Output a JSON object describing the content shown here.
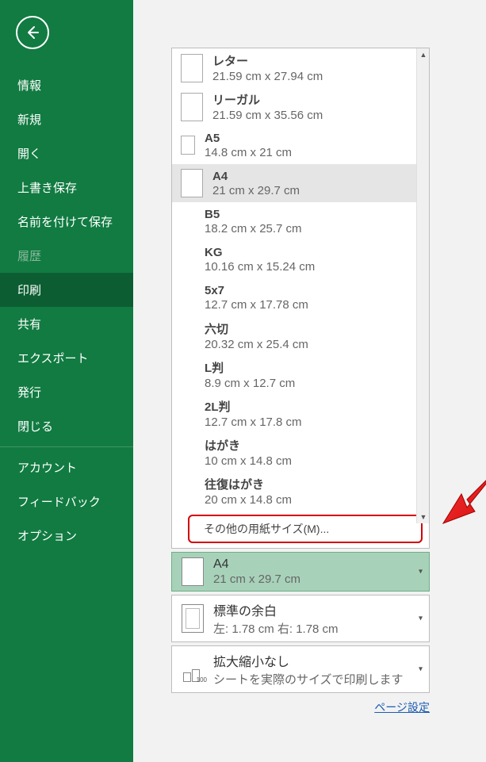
{
  "sidebar": {
    "items": [
      {
        "label": "情報",
        "active": false
      },
      {
        "label": "新規",
        "active": false
      },
      {
        "label": "開く",
        "active": false
      },
      {
        "label": "上書き保存",
        "active": false
      },
      {
        "label": "名前を付けて保存",
        "active": false
      },
      {
        "label": "履歴",
        "active": false,
        "disabled": true
      },
      {
        "label": "印刷",
        "active": true
      },
      {
        "label": "共有",
        "active": false
      },
      {
        "label": "エクスポート",
        "active": false
      },
      {
        "label": "発行",
        "active": false
      },
      {
        "label": "閉じる",
        "active": false
      }
    ],
    "items2": [
      {
        "label": "アカウント"
      },
      {
        "label": "フィードバック"
      },
      {
        "label": "オプション"
      }
    ]
  },
  "paperSizes": [
    {
      "name": "レター",
      "dim": "21.59 cm x 27.94 cm",
      "icon": "large"
    },
    {
      "name": "リーガル",
      "dim": "21.59 cm x 35.56 cm",
      "icon": "large"
    },
    {
      "name": "A5",
      "dim": "14.8 cm x 21 cm",
      "icon": "small"
    },
    {
      "name": "A4",
      "dim": "21 cm x 29.7 cm",
      "icon": "large",
      "selected": true
    },
    {
      "name": "B5",
      "dim": "18.2 cm x 25.7 cm",
      "icon": "none"
    },
    {
      "name": "KG",
      "dim": "10.16 cm x 15.24 cm",
      "icon": "none"
    },
    {
      "name": "5x7",
      "dim": "12.7 cm x 17.78 cm",
      "icon": "none"
    },
    {
      "name": "六切",
      "dim": "20.32 cm x 25.4 cm",
      "icon": "none"
    },
    {
      "name": "L判",
      "dim": "8.9 cm x 12.7 cm",
      "icon": "none"
    },
    {
      "name": "2L判",
      "dim": "12.7 cm x 17.8 cm",
      "icon": "none"
    },
    {
      "name": "はがき",
      "dim": "10 cm x 14.8 cm",
      "icon": "none"
    },
    {
      "name": "往復はがき",
      "dim": "20 cm x 14.8 cm",
      "icon": "none"
    }
  ],
  "moreSizes": "その他の用紙サイズ(M)...",
  "currentPaper": {
    "name": "A4",
    "dim": "21 cm x 29.7 cm"
  },
  "margins": {
    "title": "標準の余白",
    "sub": "左:  1.78 cm    右:  1.78 cm"
  },
  "scaling": {
    "title": "拡大縮小なし",
    "sub": "シートを実際のサイズで印刷します"
  },
  "pageSetupLink": "ページ設定"
}
